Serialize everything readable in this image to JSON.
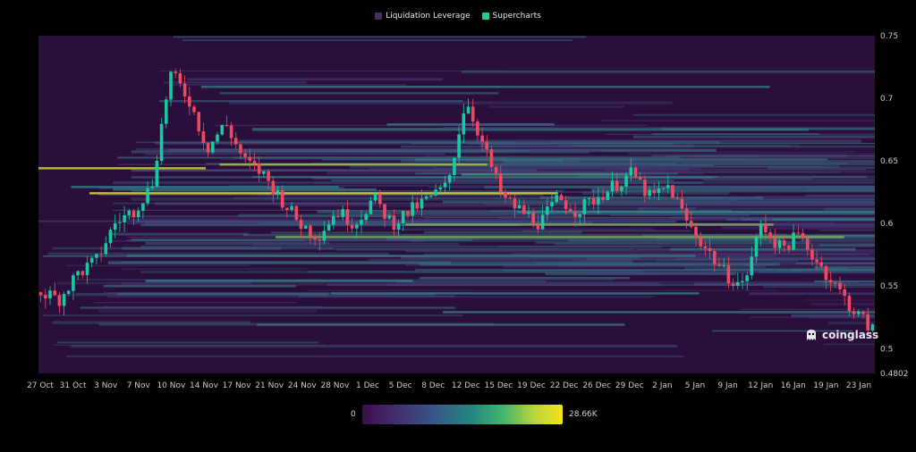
{
  "legend": {
    "items": [
      {
        "label": "Liquidation Leverage",
        "color": "#4a2a6a"
      },
      {
        "label": "Supercharts",
        "color": "#1fd18a"
      }
    ]
  },
  "watermark": {
    "text": "coinglass",
    "icon": "coinglass-logo-icon"
  },
  "colorbar": {
    "min_label": "0",
    "max_label": "28.66K"
  },
  "colors": {
    "background": "#000000",
    "heatmap_base": "#2a0f3c",
    "heatmap_low": "#4a2f72",
    "heatmap_mid": "#2f8a88",
    "heatmap_high": "#f4e41d",
    "candle_up": "#19c9a0",
    "candle_down": "#f0485e"
  },
  "chart_data": {
    "type": "heatmap",
    "title": "",
    "xlabel": "",
    "ylabel": "",
    "ylim": [
      0.4802,
      0.75
    ],
    "y_ticks": [
      "0.75",
      "0.7",
      "0.65",
      "0.6",
      "0.55",
      "0.5",
      "0.4802"
    ],
    "x_ticks": [
      "27 Oct",
      "31 Oct",
      "3 Nov",
      "7 Nov",
      "10 Nov",
      "14 Nov",
      "17 Nov",
      "21 Nov",
      "24 Nov",
      "28 Nov",
      "1 Dec",
      "5 Dec",
      "8 Dec",
      "12 Dec",
      "15 Dec",
      "19 Dec",
      "22 Dec",
      "26 Dec",
      "29 Dec",
      "2 Jan",
      "5 Jan",
      "9 Jan",
      "12 Jan",
      "16 Jan",
      "19 Jan",
      "23 Jan"
    ],
    "color_scale": {
      "min": 0,
      "max": 28660
    },
    "price_path": [
      0.545,
      0.54,
      0.56,
      0.57,
      0.6,
      0.61,
      0.63,
      0.72,
      0.7,
      0.66,
      0.68,
      0.65,
      0.64,
      0.62,
      0.6,
      0.59,
      0.61,
      0.6,
      0.62,
      0.6,
      0.61,
      0.62,
      0.63,
      0.7,
      0.66,
      0.62,
      0.61,
      0.6,
      0.62,
      0.61,
      0.62,
      0.63,
      0.64,
      0.62,
      0.63,
      0.6,
      0.58,
      0.56,
      0.55,
      0.6,
      0.58,
      0.59,
      0.57,
      0.55,
      0.53,
      0.515
    ],
    "liquidation_levels": [
      {
        "price": 0.645,
        "intensity": 0.9
      },
      {
        "price": 0.648,
        "intensity": 0.8
      },
      {
        "price": 0.6,
        "intensity": 0.7
      },
      {
        "price": 0.625,
        "intensity": 0.95
      },
      {
        "price": 0.59,
        "intensity": 0.7
      },
      {
        "price": 0.64,
        "intensity": 0.55
      },
      {
        "price": 0.555,
        "intensity": 0.45
      },
      {
        "price": 0.545,
        "intensity": 0.4
      },
      {
        "price": 0.61,
        "intensity": 0.5
      },
      {
        "price": 0.71,
        "intensity": 0.35
      },
      {
        "price": 0.68,
        "intensity": 0.35
      },
      {
        "price": 0.63,
        "intensity": 0.4
      },
      {
        "price": 0.52,
        "intensity": 0.3
      },
      {
        "price": 0.53,
        "intensity": 0.35
      },
      {
        "price": 0.575,
        "intensity": 0.4
      }
    ]
  }
}
